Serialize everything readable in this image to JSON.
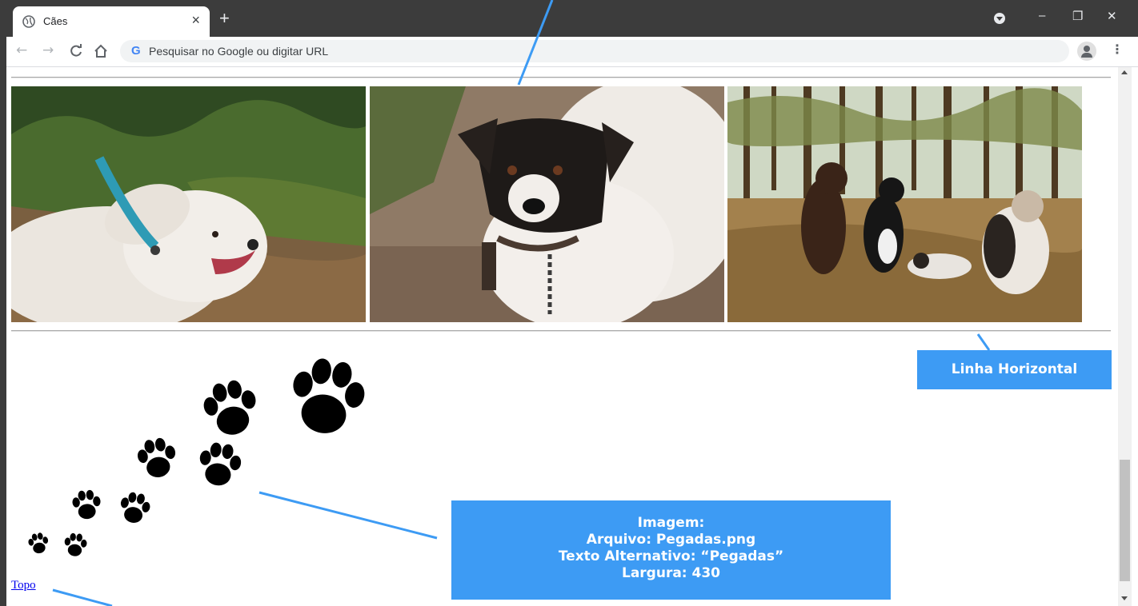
{
  "browser": {
    "tab_title": "Cães",
    "tab_close": "×",
    "new_tab": "+",
    "omnibox_placeholder": "Pesquisar no Google ou digitar URL",
    "google_logo": "G",
    "window_controls": {
      "minimize": "–",
      "restore": "❐",
      "close": "✕"
    },
    "icons": [
      "globe-icon",
      "back-arrow-icon",
      "forward-arrow-icon",
      "reload-icon",
      "home-icon",
      "profile-icon",
      "menu-icon"
    ]
  },
  "page": {
    "images": [
      {
        "subject": "white-dog-with-blue-collar",
        "colors": {
          "foliage": "#3f5a2a",
          "ground": "#8a6a44",
          "dog": "#ece7e0"
        }
      },
      {
        "subject": "black-and-white-dog-with-chain",
        "colors": {
          "ground": "#8f7a66",
          "dog": "#f0ece8",
          "head": "#1e1a18"
        }
      },
      {
        "subject": "four-dogs-in-forest",
        "colors": {
          "sky": "#dfe6d6",
          "trees": "#5a4428",
          "ground": "#9c7a45"
        }
      }
    ],
    "top_link": "Topo"
  },
  "annotations": {
    "horizontal_line": "Linha Horizontal",
    "image_info": [
      "Imagem:",
      "Arquivo: Pegadas.png",
      "Texto Alternativo: “Pegadas”",
      "Largura: 430"
    ]
  },
  "colors": {
    "callout": "#3d9bf4",
    "chrome_dark": "#3c3c3c",
    "link": "#0000ee"
  }
}
